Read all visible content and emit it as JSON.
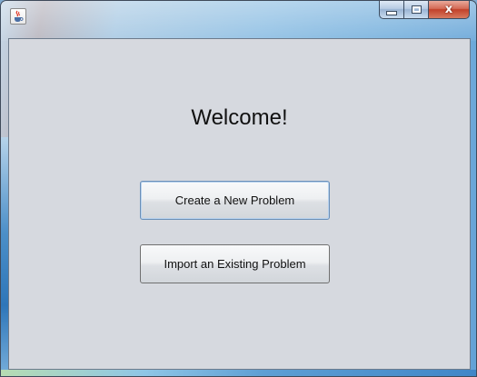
{
  "window": {
    "title": "",
    "app_icon": "java-icon",
    "controls": {
      "minimize_icon": "minimize-icon",
      "maximize_icon": "maximize-icon",
      "close_icon": "close-icon",
      "close_glyph": "x"
    }
  },
  "main": {
    "heading": "Welcome!",
    "buttons": {
      "create": "Create a New Problem",
      "import": "Import an Existing Problem"
    }
  },
  "colors": {
    "client_background": "#d6d9df",
    "close_button": "#c2412a",
    "focus_border": "#6a8fb8"
  }
}
